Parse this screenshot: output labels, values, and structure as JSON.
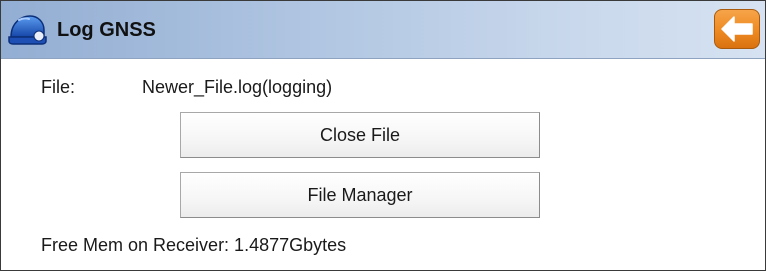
{
  "window": {
    "title": "Log GNSS",
    "app_icon": "helmet-icon",
    "back_icon": "arrow-left-icon",
    "colors": {
      "titlebar_start": "#93aed3",
      "titlebar_end": "#d6e2f1",
      "back_button": "#ee8a22",
      "app_icon": "#1e5cc8"
    }
  },
  "file": {
    "label": "File:",
    "value": "Newer_File.log(logging)"
  },
  "buttons": {
    "close_file": "Close File",
    "file_manager": "File Manager"
  },
  "status": {
    "free_mem": "Free Mem on Receiver: 1.4877Gbytes"
  }
}
